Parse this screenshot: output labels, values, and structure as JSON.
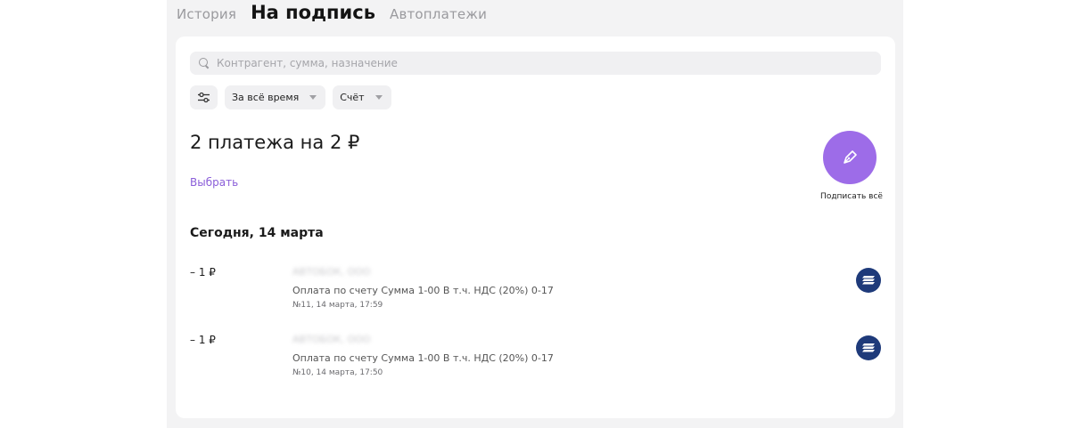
{
  "tabs": [
    {
      "label": "История",
      "active": false
    },
    {
      "label": "На подпись",
      "active": true
    },
    {
      "label": "Автоплатежи",
      "active": false
    }
  ],
  "search": {
    "placeholder": "Контрагент, сумма, назначение"
  },
  "filters": {
    "settings_icon": "sliders-icon",
    "period": "За всё время",
    "account": "Счёт"
  },
  "summary": {
    "title": "2 платежа на 2 ₽",
    "select_label": "Выбрать"
  },
  "sign_all": {
    "label": "Подписать всё",
    "icon": "pen-icon",
    "color": "#9d6ce8"
  },
  "section": {
    "date": "Сегодня, 14 марта"
  },
  "payments": [
    {
      "amount": "– 1 ₽",
      "contragent": "АВТОБОК, ООО",
      "purpose": "Оплата по счету Сумма 1-00 В т.ч. НДС (20%) 0-17",
      "meta": "№11, 14 марта, 17:59",
      "bank_icon": "bank-logo-icon"
    },
    {
      "amount": "– 1 ₽",
      "contragent": "АВТОБОК, ООО",
      "purpose": "Оплата по счету Сумма 1-00 В т.ч. НДС (20%) 0-17",
      "meta": "№10, 14 марта, 17:50",
      "bank_icon": "bank-logo-icon"
    }
  ]
}
